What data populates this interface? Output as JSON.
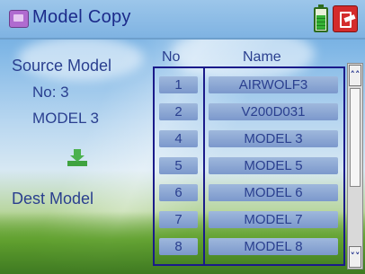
{
  "header": {
    "title": "Model Copy",
    "icons": [
      "model-folder-icon",
      "battery-icon",
      "exit-icon"
    ],
    "accent_color": "#1b2a8a"
  },
  "source": {
    "label": "Source Model",
    "no_text": "No: 3",
    "model_name": "MODEL 3"
  },
  "dest": {
    "label": "Dest Model"
  },
  "list": {
    "col_no": "No",
    "col_name": "Name",
    "rows": [
      {
        "no": "1",
        "name": "AIRWOLF3"
      },
      {
        "no": "2",
        "name": "V200D031"
      },
      {
        "no": "4",
        "name": "MODEL 3"
      },
      {
        "no": "5",
        "name": "MODEL 5"
      },
      {
        "no": "6",
        "name": "MODEL 6"
      },
      {
        "no": "7",
        "name": "MODEL 7"
      },
      {
        "no": "8",
        "name": "MODEL 8"
      }
    ]
  },
  "scrollbar": {
    "up_icon": "chevron-double-up-icon",
    "down_icon": "chevron-double-down-icon"
  }
}
